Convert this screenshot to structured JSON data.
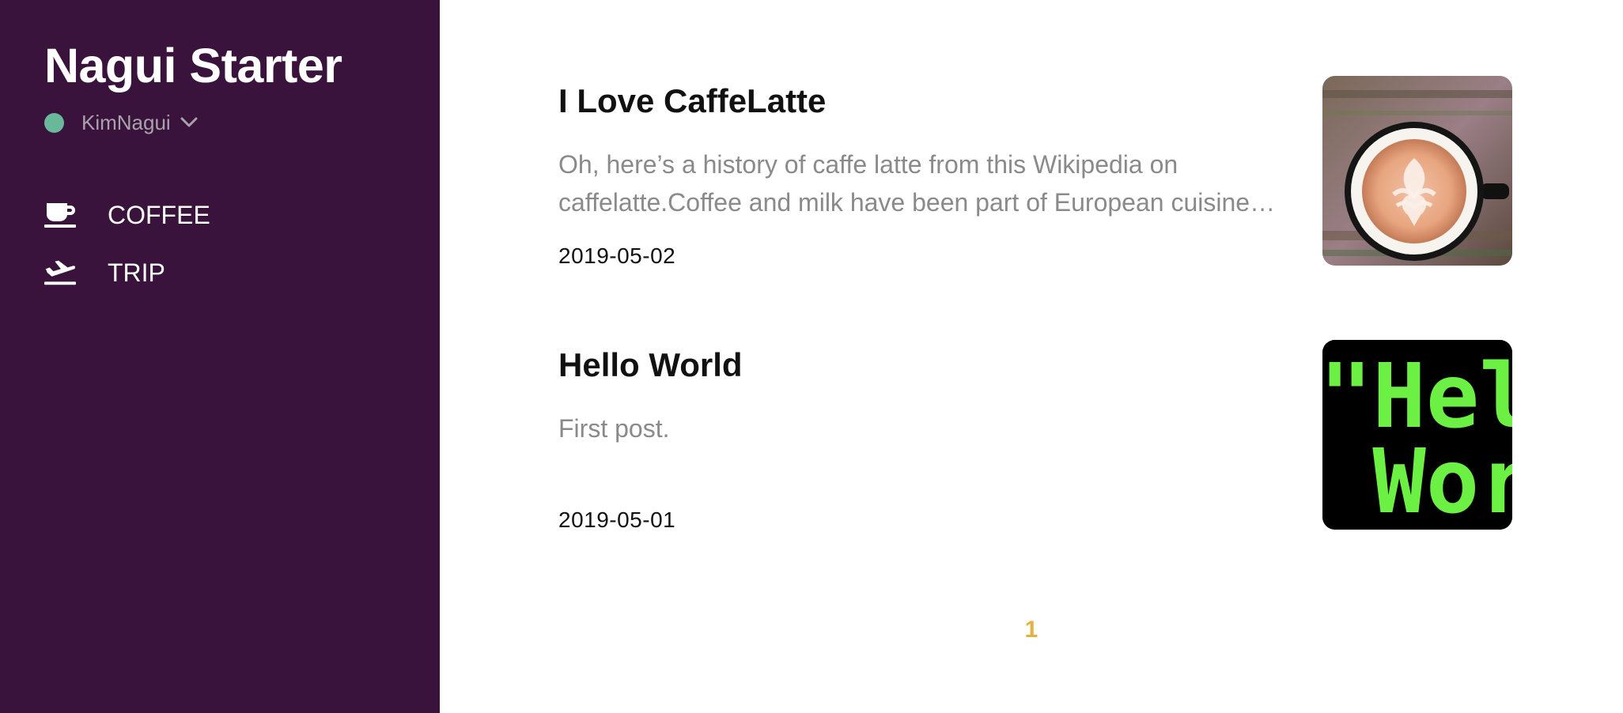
{
  "site": {
    "title": "Nagui Starter"
  },
  "user": {
    "name": "KimNagui",
    "status_color": "#67b99a"
  },
  "nav": {
    "items": [
      {
        "label": "COFFEE",
        "icon": "coffee-cup-icon"
      },
      {
        "label": "TRIP",
        "icon": "airplane-icon"
      }
    ]
  },
  "posts": [
    {
      "title": "I Love CaffeLatte",
      "excerpt_line1": "Oh, here’s a history of caffe latte from this Wikipedia on",
      "excerpt_line2": "caffelatte.Coffee and milk have been part of European cuisine…",
      "date": "2019-05-02",
      "thumbnail": "latte-art-photo"
    },
    {
      "title": "Hello World",
      "excerpt_line1": "First post.",
      "excerpt_line2": "",
      "date": "2019-05-01",
      "thumbnail": "hello-world-code-image",
      "thumbnail_text_line1": "\"Hel",
      "thumbnail_text_line2": " Wor"
    }
  ],
  "pagination": {
    "current": "1"
  },
  "colors": {
    "sidebar_bg": "#3a133d",
    "accent": "#e3b341",
    "code_green": "#6cf043"
  }
}
